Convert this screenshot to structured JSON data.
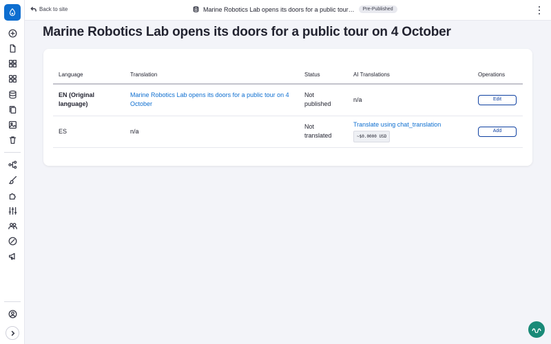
{
  "header": {
    "back_label": "Back to site",
    "node_title": "Marine Robotics Lab opens its doors for a public tour…",
    "status": "Pre-Published"
  },
  "page": {
    "title": "Marine Robotics Lab opens its doors for a public tour on 4 October"
  },
  "table": {
    "columns": {
      "language": "Language",
      "translation": "Translation",
      "status": "Status",
      "ai": "AI Translations",
      "ops": "Operations"
    },
    "rows": [
      {
        "language": "EN (Original language)",
        "translation": "Marine Robotics Lab opens its doors for a public tour on 4 October",
        "status": "Not published",
        "ai": "n/a",
        "op": "Edit"
      },
      {
        "language": "ES",
        "translation": "n/a",
        "status": "Not translated",
        "ai": "Translate using chat_translation",
        "cost": "~$0.0000 USD",
        "op": "Add"
      }
    ]
  },
  "sidebar": {
    "icons": [
      "add-icon",
      "document-icon",
      "grid-icon",
      "apps-icon",
      "database-icon",
      "copy-icon",
      "media-icon",
      "trash-icon",
      "structure-icon",
      "brush-icon",
      "puzzle-icon",
      "sliders-icon",
      "people-icon",
      "reports-icon",
      "megaphone-icon",
      "user-icon",
      "chevron-right-icon"
    ]
  },
  "colors": {
    "accent": "#0d6ed0",
    "button_border": "#0d3fa0",
    "fab": "#1a8a78"
  }
}
